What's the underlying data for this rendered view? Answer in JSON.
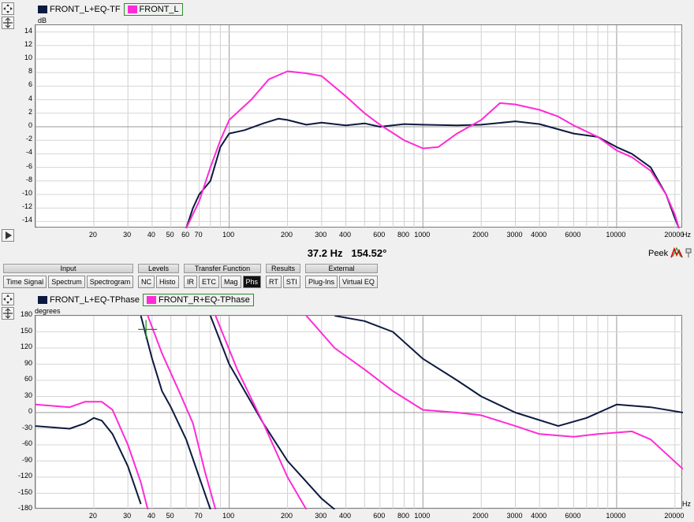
{
  "top_chart": {
    "legend": [
      {
        "label": "FRONT_L+EQ-TF",
        "color": "#0d1a40",
        "selected": false
      },
      {
        "label": "FRONT_L",
        "color": "#ff2bd6",
        "selected": true
      }
    ],
    "unit_y": "dB",
    "unit_x": "Hz",
    "y_ticks": [
      "14",
      "12",
      "10",
      "8",
      "6",
      "4",
      "2",
      "0",
      "-2",
      "-4",
      "-6",
      "-8",
      "-10",
      "-12",
      "-14"
    ],
    "x_ticks": [
      "20",
      "30",
      "40",
      "50",
      "60",
      "70",
      "100",
      "200",
      "300",
      "400",
      "600",
      "800",
      "1000",
      "2000",
      "3000",
      "4000",
      "6000",
      "10000",
      "20000"
    ]
  },
  "readout": {
    "freq": "37.2 Hz",
    "value": "154.52°"
  },
  "peek_label": "Peek",
  "toolbar": {
    "groups": [
      {
        "title": "Input",
        "buttons": [
          "Time Signal",
          "Spectrum",
          "Spectrogram"
        ]
      },
      {
        "title": "Levels",
        "buttons": [
          "NC",
          "Histo"
        ]
      },
      {
        "title": "Transfer Function",
        "buttons": [
          "IR",
          "ETC",
          "Mag",
          "Phs"
        ]
      },
      {
        "title": "Results",
        "buttons": [
          "RT",
          "STI"
        ]
      },
      {
        "title": "External",
        "buttons": [
          "Plug-Ins",
          "Virtual EQ"
        ]
      }
    ],
    "active": "Phs"
  },
  "bottom_chart": {
    "legend": [
      {
        "label": "FRONT_L+EQ-TPhase",
        "color": "#0d1a40",
        "selected": false
      },
      {
        "label": "FRONT_R+EQ-TPhase",
        "color": "#ff2bd6",
        "selected": true
      }
    ],
    "unit_y": "degrees",
    "unit_x": "Hz",
    "y_ticks": [
      "180",
      "150",
      "120",
      "90",
      "60",
      "30",
      "0",
      "-30",
      "-60",
      "-90",
      "-120",
      "-150",
      "-180"
    ],
    "x_ticks": [
      "20",
      "30",
      "40",
      "50",
      "70",
      "100",
      "200",
      "300",
      "400",
      "600",
      "800",
      "1000",
      "2000",
      "3000",
      "4000",
      "6000",
      "10000",
      "20000"
    ]
  },
  "chart_data": [
    {
      "type": "line",
      "xlabel": "Hz",
      "ylabel": "dB",
      "ylim": [
        -15,
        15
      ],
      "xlim": [
        10,
        22000
      ],
      "x_scale": "log",
      "grid": true,
      "series": [
        {
          "name": "FRONT_L+EQ-TF",
          "color": "#0d1a40",
          "points": [
            [
              60,
              -15
            ],
            [
              65,
              -12
            ],
            [
              70,
              -10
            ],
            [
              80,
              -8
            ],
            [
              90,
              -3
            ],
            [
              100,
              -1
            ],
            [
              120,
              -0.5
            ],
            [
              150,
              0.5
            ],
            [
              180,
              1.2
            ],
            [
              200,
              1.0
            ],
            [
              250,
              0.3
            ],
            [
              300,
              0.6
            ],
            [
              400,
              0.2
            ],
            [
              500,
              0.5
            ],
            [
              600,
              0.0
            ],
            [
              800,
              0.4
            ],
            [
              1000,
              0.3
            ],
            [
              1500,
              0.2
            ],
            [
              2000,
              0.3
            ],
            [
              3000,
              0.8
            ],
            [
              4000,
              0.4
            ],
            [
              6000,
              -1
            ],
            [
              8000,
              -1.5
            ],
            [
              10000,
              -3
            ],
            [
              12000,
              -4
            ],
            [
              15000,
              -6
            ],
            [
              18000,
              -10
            ],
            [
              20000,
              -13.5
            ],
            [
              21000,
              -15
            ]
          ]
        },
        {
          "name": "FRONT_L",
          "color": "#ff2bd6",
          "points": [
            [
              60,
              -15
            ],
            [
              70,
              -11
            ],
            [
              80,
              -6
            ],
            [
              90,
              -2
            ],
            [
              100,
              1
            ],
            [
              130,
              4
            ],
            [
              160,
              7
            ],
            [
              200,
              8.2
            ],
            [
              250,
              7.9
            ],
            [
              300,
              7.5
            ],
            [
              400,
              4.5
            ],
            [
              500,
              2
            ],
            [
              600,
              0.3
            ],
            [
              800,
              -2
            ],
            [
              1000,
              -3.2
            ],
            [
              1200,
              -3
            ],
            [
              1500,
              -1
            ],
            [
              2000,
              1
            ],
            [
              2500,
              3.5
            ],
            [
              3000,
              3.3
            ],
            [
              4000,
              2.5
            ],
            [
              5000,
              1.5
            ],
            [
              6000,
              0.2
            ],
            [
              8000,
              -1.5
            ],
            [
              10000,
              -3.5
            ],
            [
              12000,
              -4.5
            ],
            [
              15000,
              -6.5
            ],
            [
              18000,
              -10
            ],
            [
              20000,
              -13
            ],
            [
              21000,
              -15
            ]
          ]
        }
      ]
    },
    {
      "type": "line",
      "xlabel": "Hz",
      "ylabel": "degrees",
      "ylim": [
        -180,
        180
      ],
      "xlim": [
        10,
        22000
      ],
      "x_scale": "log",
      "grid": true,
      "series": [
        {
          "name": "FRONT_L+EQ-TPhase",
          "color": "#0d1a40",
          "segments": [
            [
              [
                10,
                -25
              ],
              [
                15,
                -30
              ],
              [
                18,
                -20
              ],
              [
                20,
                -10
              ],
              [
                22,
                -15
              ],
              [
                25,
                -40
              ],
              [
                30,
                -100
              ],
              [
                35,
                -170
              ]
            ],
            [
              [
                35,
                180
              ],
              [
                40,
                100
              ],
              [
                45,
                40
              ],
              [
                50,
                10
              ],
              [
                60,
                -50
              ],
              [
                70,
                -120
              ],
              [
                80,
                -180
              ]
            ],
            [
              [
                80,
                180
              ],
              [
                100,
                90
              ],
              [
                150,
                -20
              ],
              [
                200,
                -90
              ],
              [
                300,
                -160
              ],
              [
                350,
                -180
              ]
            ],
            [
              [
                350,
                180
              ],
              [
                500,
                170
              ],
              [
                700,
                150
              ],
              [
                1000,
                100
              ],
              [
                1500,
                60
              ],
              [
                2000,
                30
              ],
              [
                3000,
                0
              ],
              [
                5000,
                -25
              ],
              [
                7000,
                -10
              ],
              [
                10000,
                15
              ],
              [
                15000,
                10
              ],
              [
                22000,
                0
              ]
            ]
          ]
        },
        {
          "name": "FRONT_R+EQ-TPhase",
          "color": "#ff2bd6",
          "segments": [
            [
              [
                10,
                15
              ],
              [
                15,
                10
              ],
              [
                18,
                20
              ],
              [
                22,
                20
              ],
              [
                25,
                5
              ],
              [
                30,
                -60
              ],
              [
                35,
                -130
              ],
              [
                38,
                -180
              ]
            ],
            [
              [
                38,
                180
              ],
              [
                45,
                110
              ],
              [
                55,
                40
              ],
              [
                65,
                -20
              ],
              [
                75,
                -110
              ],
              [
                85,
                -180
              ]
            ],
            [
              [
                85,
                180
              ],
              [
                110,
                80
              ],
              [
                150,
                -20
              ],
              [
                200,
                -120
              ],
              [
                250,
                -180
              ]
            ],
            [
              [
                250,
                180
              ],
              [
                350,
                120
              ],
              [
                500,
                80
              ],
              [
                700,
                40
              ],
              [
                1000,
                5
              ],
              [
                1500,
                0
              ],
              [
                2000,
                -5
              ],
              [
                3000,
                -25
              ],
              [
                4000,
                -40
              ],
              [
                6000,
                -45
              ],
              [
                8000,
                -40
              ],
              [
                12000,
                -35
              ],
              [
                15000,
                -50
              ],
              [
                22000,
                -105
              ]
            ]
          ]
        }
      ],
      "cursor": {
        "x": 37.2,
        "y": 154.52
      }
    }
  ]
}
